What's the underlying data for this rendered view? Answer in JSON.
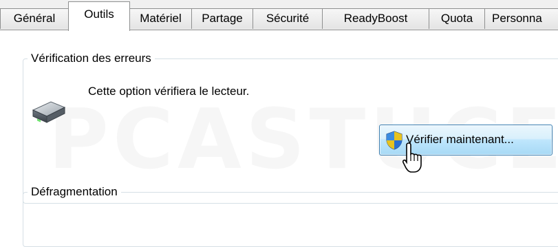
{
  "tabs": [
    {
      "label": "Général",
      "active": false
    },
    {
      "label": "Outils",
      "active": true
    },
    {
      "label": "Matériel",
      "active": false
    },
    {
      "label": "Partage",
      "active": false
    },
    {
      "label": "Sécurité",
      "active": false
    },
    {
      "label": "ReadyBoost",
      "active": false
    },
    {
      "label": "Quota",
      "active": false
    },
    {
      "label": "Personna",
      "active": false
    }
  ],
  "error_check": {
    "title": "Vérification des erreurs",
    "description": "Cette option vérifiera le lecteur.",
    "button_label": "Vérifier maintenant...",
    "icon": "hard-drive-icon",
    "button_icon": "uac-shield-icon"
  },
  "defrag": {
    "title": "Défragmentation"
  },
  "watermark": "PCASTUCES",
  "colors": {
    "button_border": "#3c7fb1",
    "button_fill": "#bee6fd",
    "groupbox_border": "#d5dfe5",
    "tab_border": "#8e8f8f"
  }
}
